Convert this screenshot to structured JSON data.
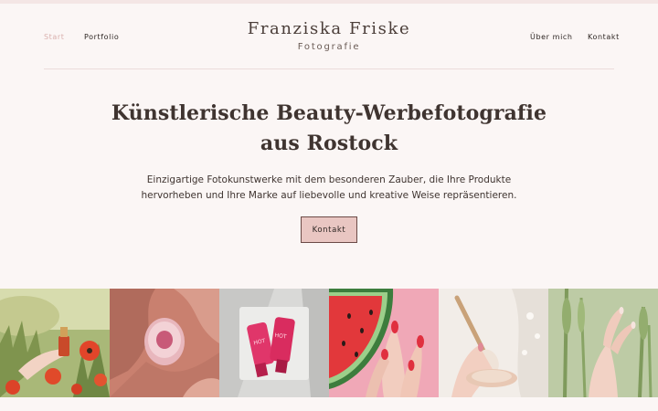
{
  "nav": {
    "left": [
      {
        "label": "Start",
        "active": true
      },
      {
        "label": "Portfolio",
        "active": false
      }
    ],
    "right": [
      {
        "label": "Über mich"
      },
      {
        "label": "Kontakt"
      }
    ]
  },
  "brand": {
    "name": "Franziska Friske",
    "subtitle": "Fotografie"
  },
  "hero": {
    "title_line1": "Künstlerische Beauty-Werbefotografie",
    "title_line2": "aus Rostock",
    "text_line1": "Einzigartige Fotokunstwerke mit dem besonderen Zauber, die Ihre Produkte",
    "text_line2": "hervorheben und Ihre Marke auf liebevolle und kreative Weise repräsentieren.",
    "cta_label": "Kontakt"
  },
  "gallery": {
    "images": [
      {
        "name": "hand-poppies-nail-polish-photo"
      },
      {
        "name": "pink-fabric-bottle-photo"
      },
      {
        "name": "hot-lips-tubes-photo"
      },
      {
        "name": "watermelon-nails-photo"
      },
      {
        "name": "brush-powder-photo"
      },
      {
        "name": "wheat-field-hand-photo"
      }
    ]
  },
  "colors": {
    "background": "#fbf6f5",
    "accent": "#e9c6c2",
    "active_link": "#d9b0ad",
    "text": "#3f3430"
  }
}
